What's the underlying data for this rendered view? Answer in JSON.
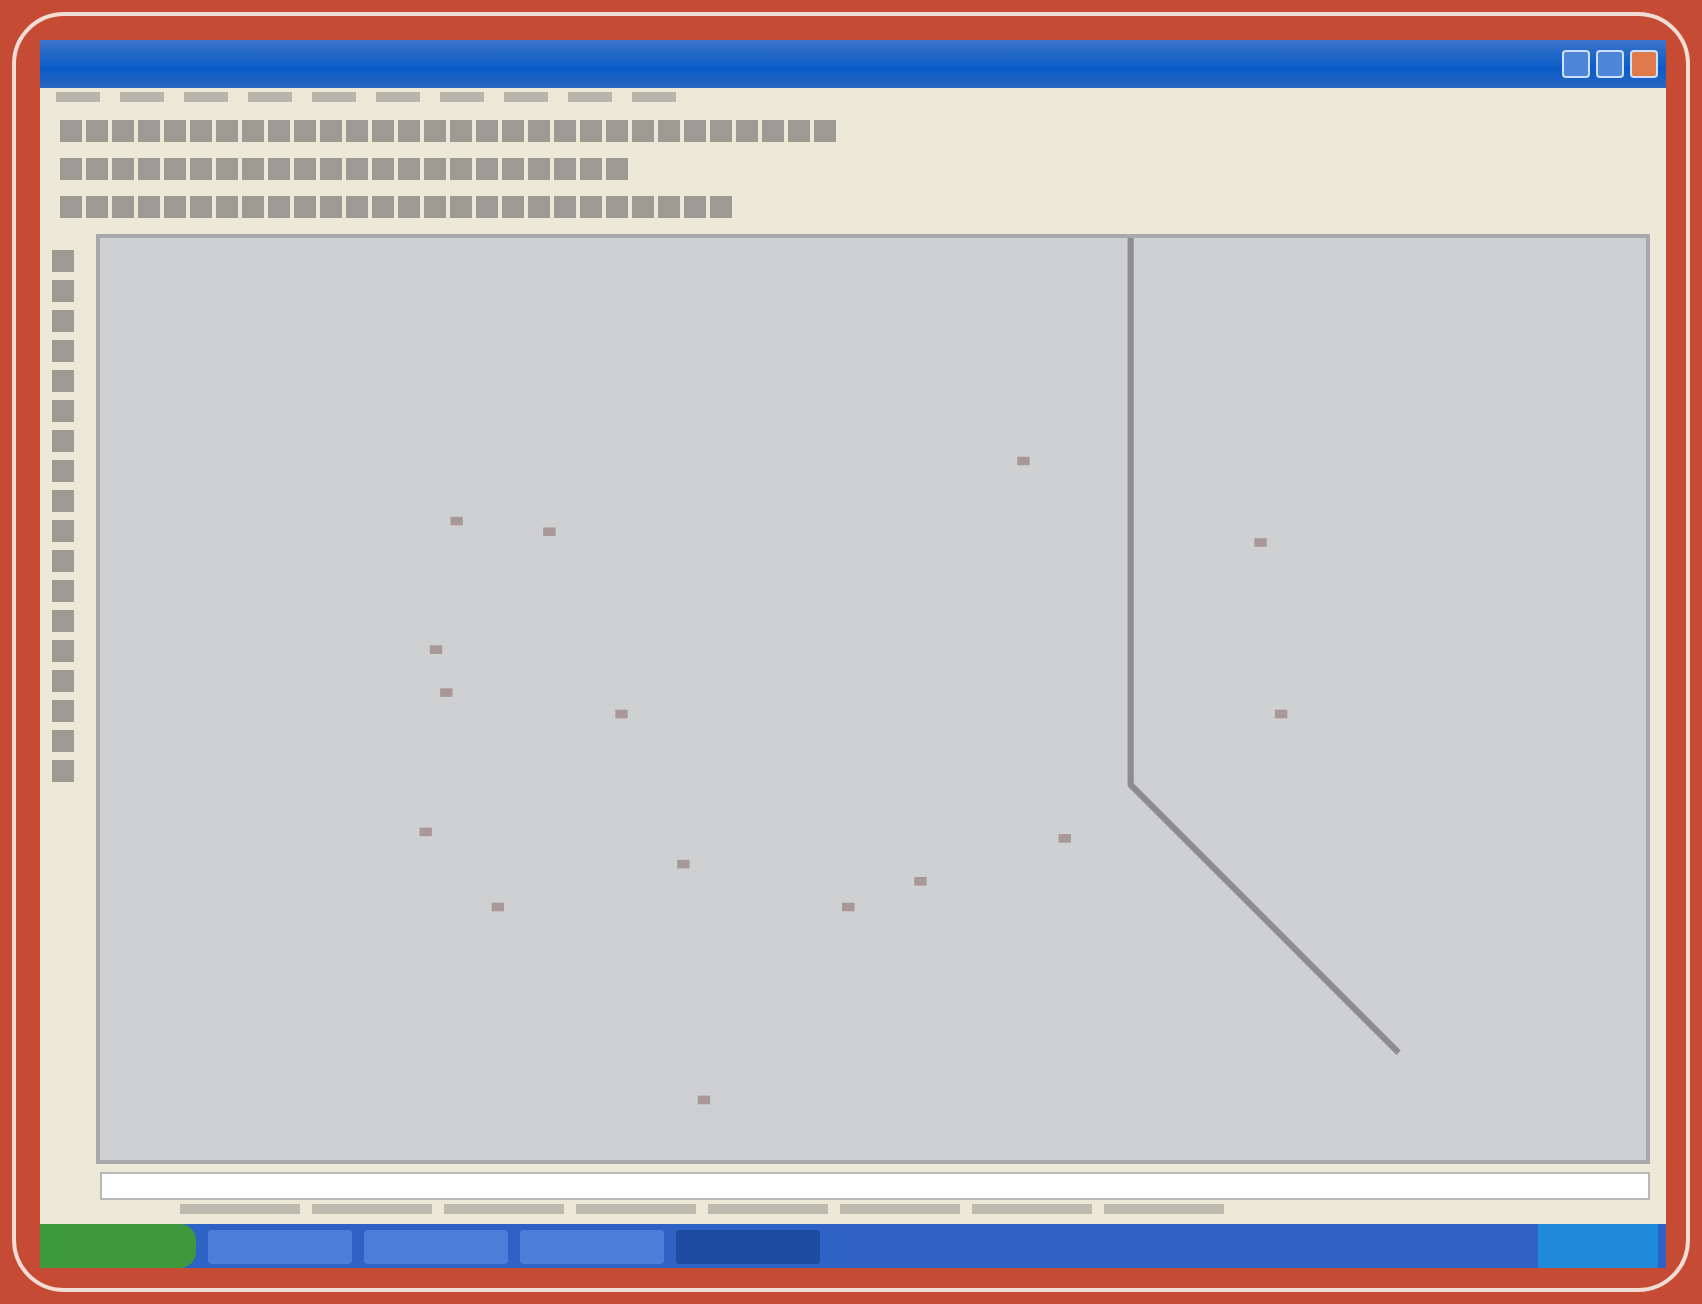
{
  "window": {
    "active": true
  },
  "taskbar": {
    "tasks": [
      {
        "kind": "task",
        "selected": false
      },
      {
        "kind": "task",
        "selected": false
      },
      {
        "kind": "task",
        "selected": false
      },
      {
        "kind": "task",
        "selected": true
      }
    ]
  }
}
